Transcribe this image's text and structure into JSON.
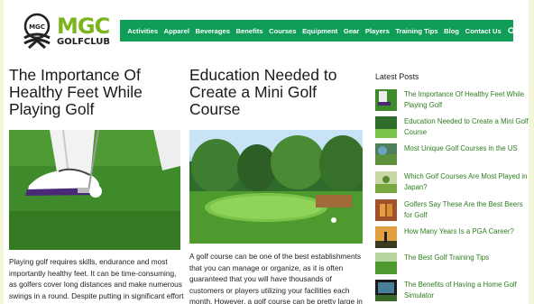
{
  "logo": {
    "big": "MGC",
    "small": "GOLFCLUB",
    "badge": "MGC"
  },
  "nav": {
    "items": [
      "Activities",
      "Apparel",
      "Beverages",
      "Benefits",
      "Courses",
      "Equipment",
      "Gear",
      "Players",
      "Training Tips",
      "Blog",
      "Contact Us"
    ],
    "search_icon": "search-icon"
  },
  "articles": [
    {
      "title": "The Importance Of Healthy Feet While Playing Golf",
      "excerpt": "Playing golf requires skills, endurance and most importantly healthy feet. It can be time-consuming, as golfers cover long distances and make numerous swings in a round. Despite putting in significant effort"
    },
    {
      "title": "Education Needed to Create a Mini Golf Course",
      "excerpt": "A golf course can be one of the best establishments that you can manage or organize, as it is often guaranteed that you will have thousands of customers or players utilizing your facilities each month. However, a golf course can be pretty large in"
    }
  ],
  "sidebar": {
    "title": "Latest Posts",
    "posts": [
      "The Importance Of Healthy Feet While Playing Golf",
      "Education Needed to Create a Mini Golf Course",
      "Most Unique Golf Courses in the US",
      "Which Golf Courses Are Most Played in Japan?",
      "Golfers Say These Are the Best Beers for Golf",
      "How Many Years Is a PGA Career?",
      "The Best Golf Training Tips",
      "The Benefits of Having a Home Golf Simulator"
    ]
  },
  "colors": {
    "nav_bg": "#0f9d58",
    "logo_green": "#7ab51d",
    "link_green": "#2e7d1f"
  }
}
